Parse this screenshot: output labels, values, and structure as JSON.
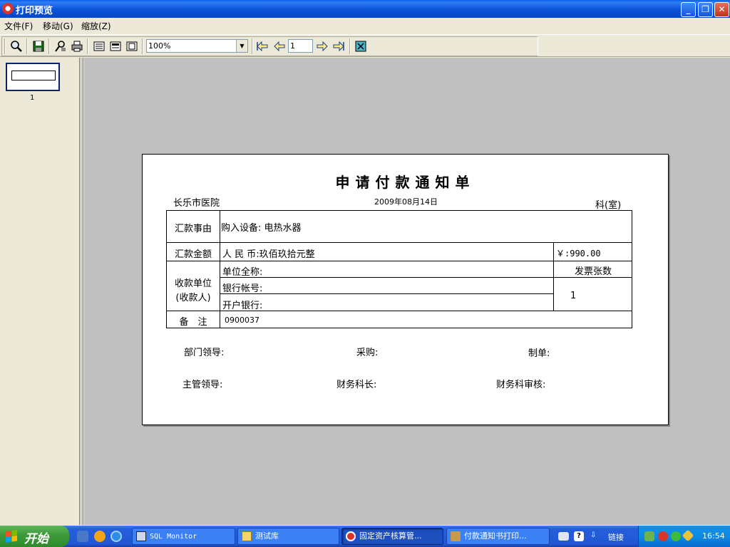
{
  "window": {
    "title": "打印预览"
  },
  "menu": {
    "file": "文件(F)",
    "move": "移动(G)",
    "zoom": "缩放(Z)"
  },
  "toolbar": {
    "zoom_value": "100%",
    "page_number": "1"
  },
  "thumbnails": [
    {
      "label": "1"
    }
  ],
  "document": {
    "title": "申请付款通知单",
    "hospital": "长乐市医院",
    "date": "2009年08月14日",
    "department": "科(室)",
    "table": {
      "reason_label": "汇款事由",
      "reason_value": "购入设备: 电热水器",
      "amount_label": "汇款金额",
      "amount_value": "人 民 币:玖佰玖拾元整",
      "amount_numeric": "￥:990.00",
      "payee_label_line1": "收款单位",
      "payee_label_line2": "(收款人)",
      "unit_name_label": "单位全称:",
      "bank_account_label": "银行帐号:",
      "bank_name_label": "开户银行:",
      "invoice_count_label": "发票张数",
      "invoice_count_value": "1",
      "remark_label": "备　注",
      "remark_value": "0900037"
    },
    "signatures": {
      "dept_leader": "部门领导:",
      "purchasing": "采购:",
      "prepared_by": "制单:",
      "supervisor": "主管领导:",
      "finance_head": "财务科长:",
      "finance_auditor": "财务科审核:"
    }
  },
  "taskbar": {
    "start_label": "开始",
    "tasks": [
      {
        "label": "SQL Monitor"
      },
      {
        "label": "测试库"
      },
      {
        "label": "固定资产核算管..."
      },
      {
        "label": "付款通知书打印..."
      }
    ],
    "links_label": "链接",
    "clock": "16:54"
  }
}
